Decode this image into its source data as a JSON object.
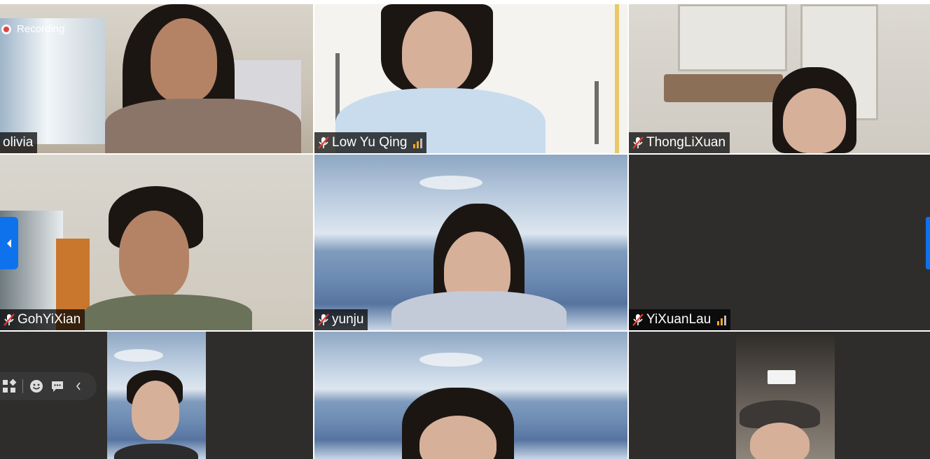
{
  "recording": {
    "label": "Recording"
  },
  "participants": [
    {
      "name": "olivia",
      "muted": false,
      "speaking_indicator": false
    },
    {
      "name": "Low Yu Qing",
      "muted": true,
      "speaking_indicator": true
    },
    {
      "name": "ThongLiXuan",
      "muted": true,
      "speaking_indicator": false
    },
    {
      "name": "GohYiXian",
      "muted": true,
      "speaking_indicator": false
    },
    {
      "name": "yunju",
      "muted": true,
      "speaking_indicator": false
    },
    {
      "name": "YiXuanLau",
      "muted": true,
      "speaking_indicator": true
    },
    {
      "name": "",
      "muted": false,
      "speaking_indicator": false
    },
    {
      "name": "",
      "muted": false,
      "speaking_indicator": false
    },
    {
      "name": "",
      "muted": false,
      "speaking_indicator": false
    }
  ],
  "icons": {
    "mute": "microphone-muted-icon",
    "signal": "signal-strength-icon",
    "recording": "recording-dot-icon",
    "prev_page": "chevron-left-icon",
    "next_page": "chevron-right-icon",
    "toolbar_apps": "apps-icon",
    "toolbar_reactions": "smiley-icon",
    "toolbar_chat": "chat-icon",
    "toolbar_collapse": "chevron-left-icon"
  },
  "colors": {
    "accent": "#0e72ed",
    "recording": "#e53935",
    "signal": "#f5a623",
    "tile_bg": "#2f2d2b"
  }
}
